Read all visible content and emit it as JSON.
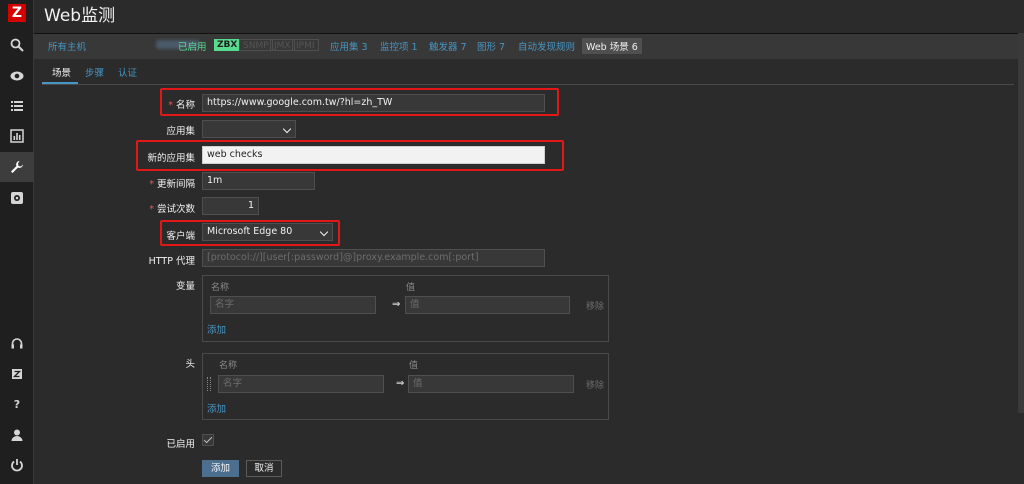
{
  "header": {
    "title": "Web监测"
  },
  "navbar": {
    "all_hosts": "所有主机",
    "enabled": "已启用",
    "zbx": "ZBX",
    "snmp": "SNMP",
    "jmx": "JMX",
    "ipmi": "IPMI",
    "applications": "应用集 3",
    "items": "监控项 1",
    "triggers": "触发器 7",
    "graphs": "图形 7",
    "discovery": "自动发现规则",
    "web_scenarios": "Web 场景 6"
  },
  "tabs": {
    "scenario": "场景",
    "steps": "步骤",
    "auth": "认证"
  },
  "form": {
    "name_label": "名称",
    "name_value": "https://www.google.com.tw/?hl=zh_TW",
    "application_label": "应用集",
    "application_value": "",
    "new_application_label": "新的应用集",
    "new_application_value": "web checks",
    "update_interval_label": "更新间隔",
    "update_interval_value": "1m",
    "attempts_label": "尝试次数",
    "attempts_value": "1",
    "agent_label": "客户端",
    "agent_value": "Microsoft Edge 80",
    "proxy_label": "HTTP 代理",
    "proxy_placeholder": "[protocol://][user[:password]@]proxy.example.com[:port]",
    "variables_label": "变量",
    "headers_label": "头",
    "col_name": "名称",
    "col_value": "值",
    "name_placeholder": "名字",
    "value_placeholder": "值",
    "arrow": "⇒",
    "remove": "移除",
    "add_link": "添加",
    "enabled_label": "已启用",
    "enabled_checked": true
  },
  "buttons": {
    "add": "添加",
    "cancel": "取消"
  },
  "colors": {
    "accent": "#4796c4",
    "enabled_green": "#59db8f",
    "highlight_red": "#e21818",
    "brand_red": "#d40000"
  },
  "icons": {
    "logo": "zabbix-logo-icon",
    "search": "search-icon",
    "monitoring": "eye-icon",
    "inventory": "list-icon",
    "reports": "chart-icon",
    "configuration": "wrench-icon",
    "administration": "gear-icon",
    "support": "headset-icon",
    "share": "zabbix-share-icon",
    "help": "help-icon",
    "user": "user-icon",
    "logout": "power-icon"
  }
}
